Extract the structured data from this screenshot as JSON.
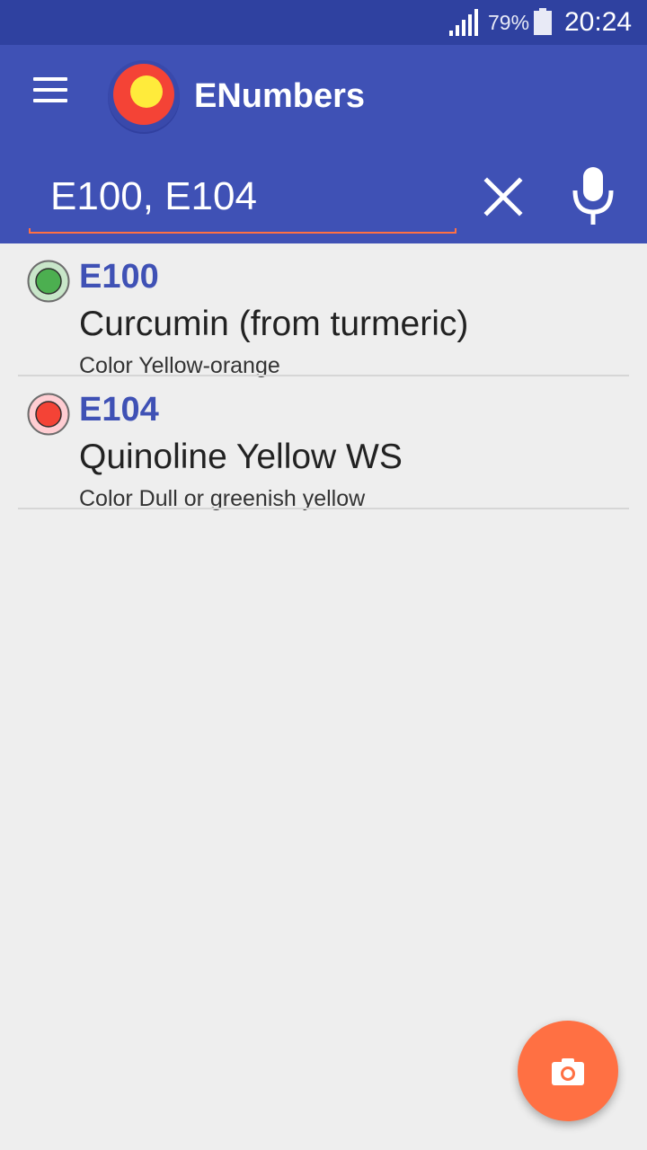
{
  "status_bar": {
    "battery_percent": "79%",
    "time": "20:24",
    "signal_icon": "signal-icon",
    "battery_icon": "battery-icon"
  },
  "app_bar": {
    "menu_icon": "hamburger-menu-icon",
    "logo_icon": "app-logo-icon",
    "title": "ENumbers"
  },
  "search": {
    "value": "E100, E104",
    "placeholder": "",
    "clear_icon": "close-icon",
    "voice_icon": "microphone-icon"
  },
  "results": [
    {
      "code": "E100",
      "name": "Curcumin (from turmeric)",
      "description": "Color Yellow-orange",
      "status": "safe",
      "status_color": "#4caf50"
    },
    {
      "code": "E104",
      "name": "Quinoline Yellow WS",
      "description": "Color Dull or greenish yellow",
      "status": "dangerous",
      "status_color": "#f44336"
    }
  ],
  "fab": {
    "icon": "camera-icon"
  },
  "colors": {
    "primary": "#3f51b5",
    "primary_dark": "#2f41a0",
    "accent": "#ff7043",
    "background": "#eeeeee"
  }
}
